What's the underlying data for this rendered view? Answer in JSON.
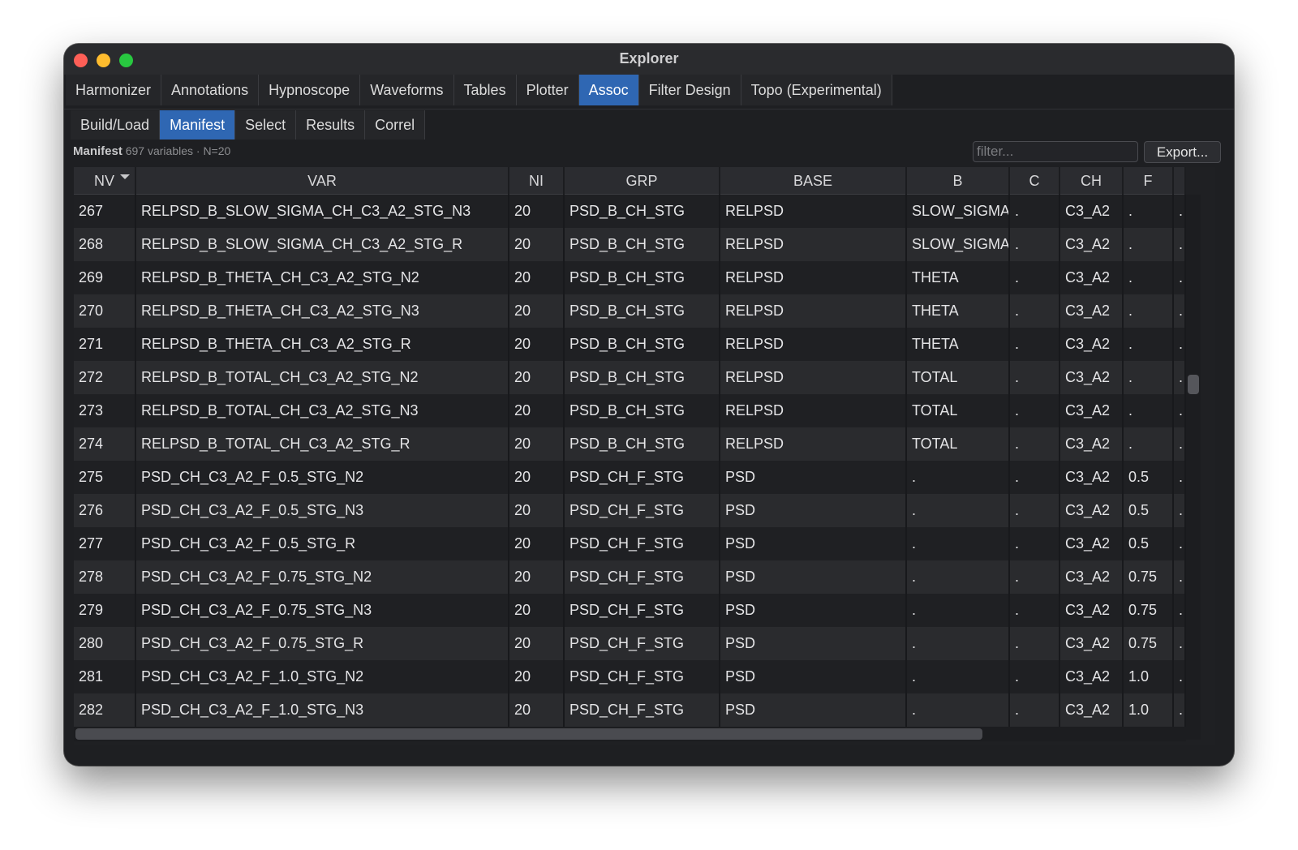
{
  "window": {
    "title": "Explorer"
  },
  "main_tabs": [
    {
      "label": "Harmonizer",
      "active": false
    },
    {
      "label": "Annotations",
      "active": false
    },
    {
      "label": "Hypnoscope",
      "active": false
    },
    {
      "label": "Waveforms",
      "active": false
    },
    {
      "label": "Tables",
      "active": false
    },
    {
      "label": "Plotter",
      "active": false
    },
    {
      "label": "Assoc",
      "active": true
    },
    {
      "label": "Filter Design",
      "active": false
    },
    {
      "label": "Topo (Experimental)",
      "active": false
    }
  ],
  "sub_tabs": [
    {
      "label": "Build/Load",
      "active": false
    },
    {
      "label": "Manifest",
      "active": true
    },
    {
      "label": "Select",
      "active": false
    },
    {
      "label": "Results",
      "active": false
    },
    {
      "label": "Correl",
      "active": false
    }
  ],
  "info": {
    "title": "Manifest",
    "details": "697 variables  ·  N=20"
  },
  "filter": {
    "placeholder": "filter...",
    "value": ""
  },
  "export_label": "Export...",
  "table": {
    "columns": [
      "NV",
      "VAR",
      "NI",
      "GRP",
      "BASE",
      "B",
      "C",
      "CH",
      "F",
      ""
    ],
    "sort_column": "NV",
    "rows": [
      [
        "267",
        "RELPSD_B_SLOW_SIGMA_CH_C3_A2_STG_N3",
        "20",
        "PSD_B_CH_STG",
        "RELPSD",
        "SLOW_SIGMA",
        ".",
        "C3_A2",
        ".",
        "."
      ],
      [
        "268",
        "RELPSD_B_SLOW_SIGMA_CH_C3_A2_STG_R",
        "20",
        "PSD_B_CH_STG",
        "RELPSD",
        "SLOW_SIGMA",
        ".",
        "C3_A2",
        ".",
        "."
      ],
      [
        "269",
        "RELPSD_B_THETA_CH_C3_A2_STG_N2",
        "20",
        "PSD_B_CH_STG",
        "RELPSD",
        "THETA",
        ".",
        "C3_A2",
        ".",
        "."
      ],
      [
        "270",
        "RELPSD_B_THETA_CH_C3_A2_STG_N3",
        "20",
        "PSD_B_CH_STG",
        "RELPSD",
        "THETA",
        ".",
        "C3_A2",
        ".",
        "."
      ],
      [
        "271",
        "RELPSD_B_THETA_CH_C3_A2_STG_R",
        "20",
        "PSD_B_CH_STG",
        "RELPSD",
        "THETA",
        ".",
        "C3_A2",
        ".",
        "."
      ],
      [
        "272",
        "RELPSD_B_TOTAL_CH_C3_A2_STG_N2",
        "20",
        "PSD_B_CH_STG",
        "RELPSD",
        "TOTAL",
        ".",
        "C3_A2",
        ".",
        "."
      ],
      [
        "273",
        "RELPSD_B_TOTAL_CH_C3_A2_STG_N3",
        "20",
        "PSD_B_CH_STG",
        "RELPSD",
        "TOTAL",
        ".",
        "C3_A2",
        ".",
        "."
      ],
      [
        "274",
        "RELPSD_B_TOTAL_CH_C3_A2_STG_R",
        "20",
        "PSD_B_CH_STG",
        "RELPSD",
        "TOTAL",
        ".",
        "C3_A2",
        ".",
        "."
      ],
      [
        "275",
        "PSD_CH_C3_A2_F_0.5_STG_N2",
        "20",
        "PSD_CH_F_STG",
        "PSD",
        ".",
        ".",
        "C3_A2",
        "0.5",
        "."
      ],
      [
        "276",
        "PSD_CH_C3_A2_F_0.5_STG_N3",
        "20",
        "PSD_CH_F_STG",
        "PSD",
        ".",
        ".",
        "C3_A2",
        "0.5",
        "."
      ],
      [
        "277",
        "PSD_CH_C3_A2_F_0.5_STG_R",
        "20",
        "PSD_CH_F_STG",
        "PSD",
        ".",
        ".",
        "C3_A2",
        "0.5",
        "."
      ],
      [
        "278",
        "PSD_CH_C3_A2_F_0.75_STG_N2",
        "20",
        "PSD_CH_F_STG",
        "PSD",
        ".",
        ".",
        "C3_A2",
        "0.75",
        "."
      ],
      [
        "279",
        "PSD_CH_C3_A2_F_0.75_STG_N3",
        "20",
        "PSD_CH_F_STG",
        "PSD",
        ".",
        ".",
        "C3_A2",
        "0.75",
        "."
      ],
      [
        "280",
        "PSD_CH_C3_A2_F_0.75_STG_R",
        "20",
        "PSD_CH_F_STG",
        "PSD",
        ".",
        ".",
        "C3_A2",
        "0.75",
        "."
      ],
      [
        "281",
        "PSD_CH_C3_A2_F_1.0_STG_N2",
        "20",
        "PSD_CH_F_STG",
        "PSD",
        ".",
        ".",
        "C3_A2",
        "1.0",
        "."
      ],
      [
        "282",
        "PSD_CH_C3_A2_F_1.0_STG_N3",
        "20",
        "PSD_CH_F_STG",
        "PSD",
        ".",
        ".",
        "C3_A2",
        "1.0",
        "."
      ]
    ]
  }
}
